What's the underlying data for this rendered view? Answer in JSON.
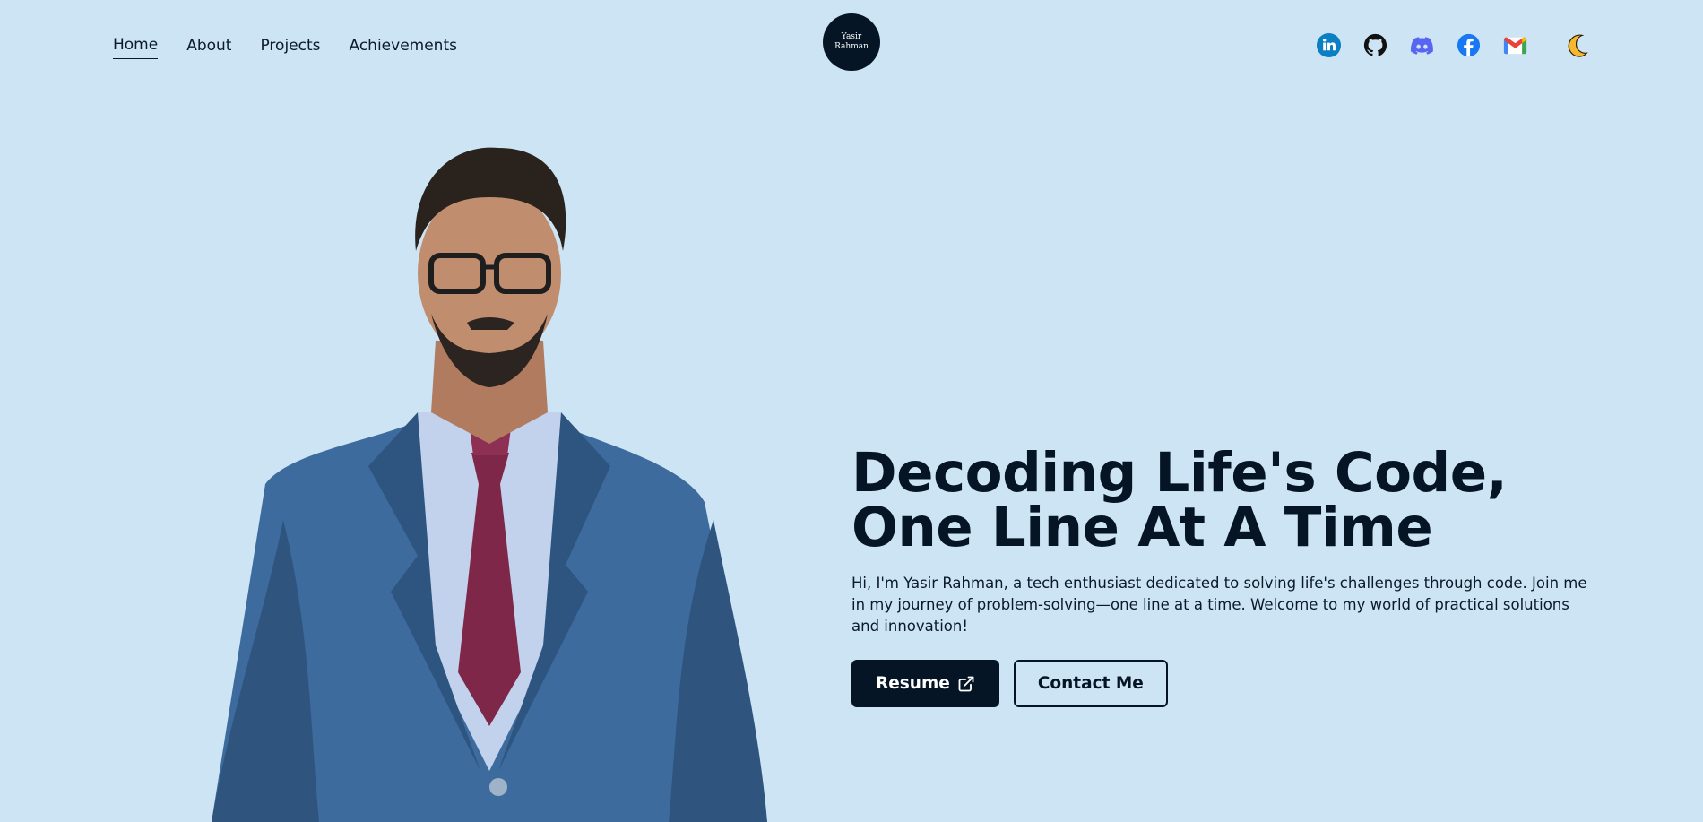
{
  "nav": {
    "items": [
      {
        "label": "Home",
        "active": true
      },
      {
        "label": "About",
        "active": false
      },
      {
        "label": "Projects",
        "active": false
      },
      {
        "label": "Achievements",
        "active": false
      }
    ]
  },
  "logo": {
    "line1": "Yasir",
    "line2": "Rahman"
  },
  "socials": [
    {
      "name": "linkedin-icon",
      "color": "#0a7fc4"
    },
    {
      "name": "github-icon",
      "color": "#111111"
    },
    {
      "name": "discord-icon",
      "color": "#5865f2"
    },
    {
      "name": "facebook-icon",
      "color": "#1877f2"
    },
    {
      "name": "gmail-icon",
      "color": "#ea4335"
    }
  ],
  "theme_toggle": {
    "icon": "moon-icon",
    "color": "#f5b82e"
  },
  "hero": {
    "title_line1": "Decoding Life's Code,",
    "title_line2": "One Line At A Time",
    "description": "Hi, I'm Yasir Rahman, a tech enthusiast dedicated to solving life's challenges through code. Join me in my journey of problem-solving—one line at a time. Welcome to my world of practical solutions and innovation!",
    "primary_button": "Resume",
    "secondary_button": "Contact Me"
  },
  "colors": {
    "background": "#cce4f3",
    "accent": "#061526"
  }
}
